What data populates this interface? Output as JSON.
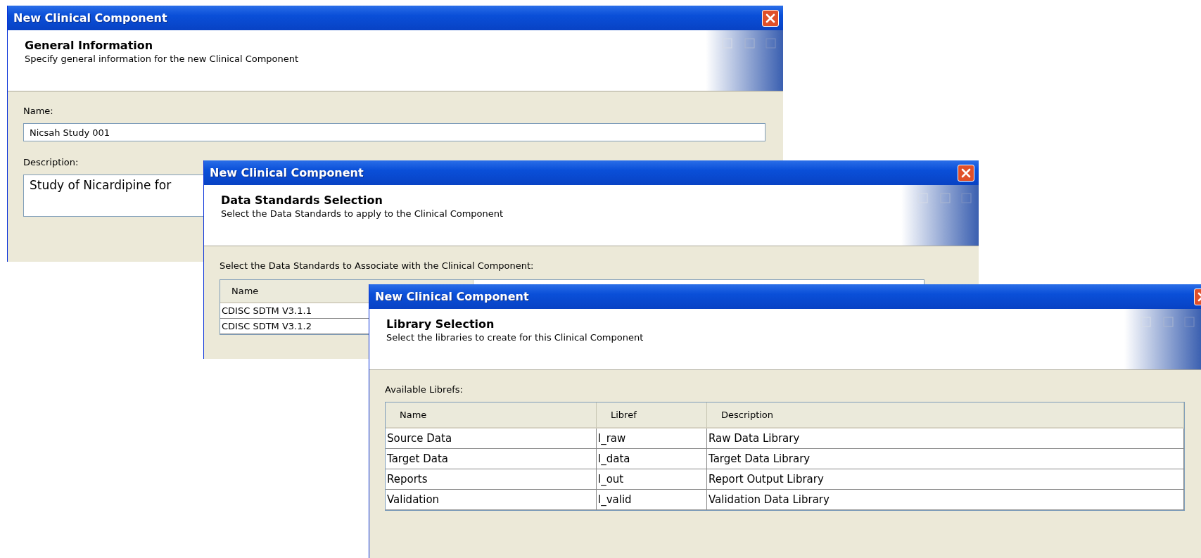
{
  "windows": [
    {
      "kind": "form",
      "title": "New Clinical Component",
      "heading": "General Information",
      "subheading": "Specify general information for the new Clinical Component",
      "fields": [
        {
          "kind": "line",
          "label": "Name:",
          "value": "Nicsah Study 001"
        },
        {
          "kind": "area",
          "label": "Description:",
          "value": "Study of Nicardipine for"
        }
      ]
    },
    {
      "kind": "table",
      "title": "New Clinical Component",
      "heading": "Data Standards Selection",
      "subheading": "Select the Data Standards to apply to the Clinical Component",
      "table_label": "Select the Data Standards to Associate with the Clinical Component:",
      "columns": [
        "Name"
      ],
      "rows": [
        [
          "CDISC SDTM V3.1.1"
        ],
        [
          "CDISC SDTM V3.1.2"
        ]
      ]
    },
    {
      "kind": "table",
      "title": "New Clinical Component",
      "heading": "Library Selection",
      "subheading": "Select the libraries to create for this Clinical Component",
      "table_label": "Available Librefs:",
      "columns": [
        "Name",
        "Libref",
        "Description"
      ],
      "rows": [
        [
          "Source Data",
          "l_raw",
          "Raw Data Library"
        ],
        [
          "Target Data",
          "l_data",
          "Target Data Library"
        ],
        [
          "Reports",
          "l_out",
          "Report Output Library"
        ],
        [
          "Validation",
          "l_valid",
          "Validation Data Library"
        ]
      ]
    }
  ]
}
